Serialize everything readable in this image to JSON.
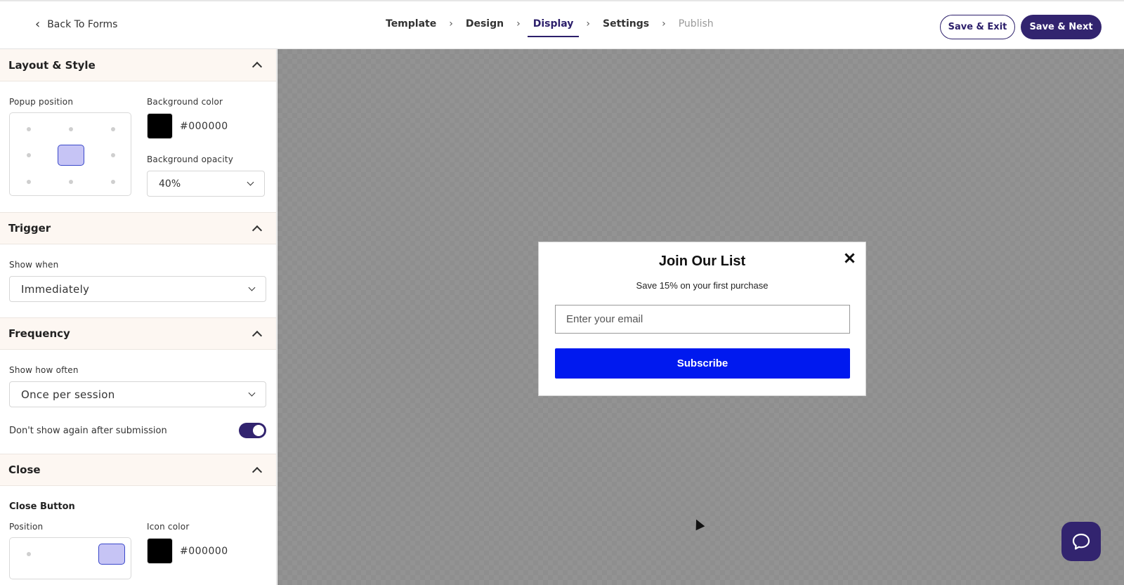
{
  "header": {
    "back_label": "Back To Forms",
    "steps": [
      {
        "label": "Template",
        "state": "done"
      },
      {
        "label": "Design",
        "state": "done"
      },
      {
        "label": "Display",
        "state": "active"
      },
      {
        "label": "Settings",
        "state": "upcoming"
      },
      {
        "label": "Publish",
        "state": "disabled"
      }
    ],
    "save_exit_label": "Save & Exit",
    "save_next_label": "Save & Next"
  },
  "sidebar": {
    "layout": {
      "title": "Layout & Style",
      "popup_position_label": "Popup position",
      "popup_position_selected": "center",
      "bg_color_label": "Background color",
      "bg_color_value": "#000000",
      "bg_opacity_label": "Background opacity",
      "bg_opacity_value": "40%"
    },
    "trigger": {
      "title": "Trigger",
      "show_when_label": "Show when",
      "show_when_value": "Immediately"
    },
    "frequency": {
      "title": "Frequency",
      "show_how_often_label": "Show how often",
      "show_how_often_value": "Once per session",
      "dont_show_label": "Don't show again after submission",
      "dont_show_enabled": true
    },
    "close": {
      "title": "Close",
      "close_button_label": "Close Button",
      "position_label": "Position",
      "position_selected": "top-right",
      "icon_color_label": "Icon color",
      "icon_color_value": "#000000"
    }
  },
  "popup": {
    "title": "Join Our List",
    "subtitle": "Save 15% on your first purchase",
    "email_placeholder": "Enter your email",
    "subscribe_label": "Subscribe"
  },
  "colors": {
    "brand": "#32246f",
    "subscribe_button": "#0019ef",
    "canvas_bg": "#8e8e8e",
    "position_selected_fill": "#c6c4f5"
  }
}
